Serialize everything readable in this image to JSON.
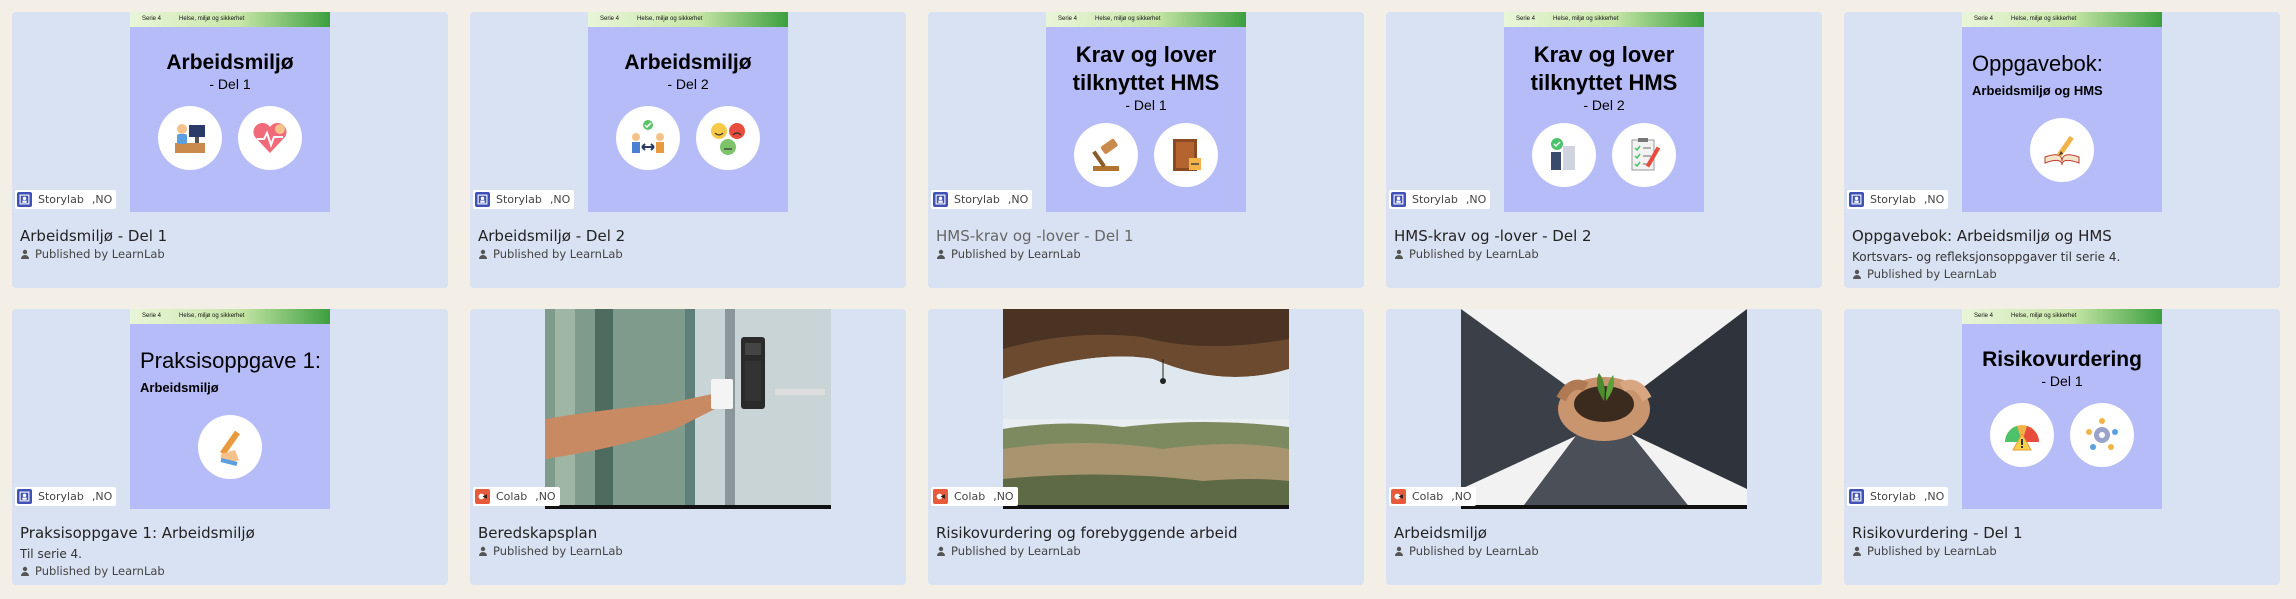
{
  "cover_bar": {
    "series": "Serie 4",
    "topic": "Helse, miljø og sikkerhet"
  },
  "publisher_prefix": "Published by",
  "cards": [
    {
      "title": "Arbeidsmiljø - Del 1",
      "publisher": "LearnLab",
      "source": "Storylab",
      "lang": ",NO",
      "cover_title": "Arbeidsmiljø",
      "cover_sub": "- Del 1",
      "icons": [
        "office-worker-icon",
        "heart-health-icon"
      ]
    },
    {
      "title": "Arbeidsmiljø - Del 2",
      "publisher": "LearnLab",
      "source": "Storylab",
      "lang": ",NO",
      "cover_title": "Arbeidsmiljø",
      "cover_sub": "- Del 2",
      "icons": [
        "people-exchange-icon",
        "mood-faces-icon"
      ]
    },
    {
      "title": "HMS-krav og -lover - Del 1",
      "publisher": "LearnLab",
      "source": "Storylab",
      "lang": ",NO",
      "cover_title_l1": "Krav og lover",
      "cover_title_l2": "tilknyttet HMS",
      "cover_sub": "- Del 1",
      "icons": [
        "gavel-icon",
        "law-book-icon"
      ]
    },
    {
      "title": "HMS-krav og -lover - Del 2",
      "publisher": "LearnLab",
      "source": "Storylab",
      "lang": ",NO",
      "cover_title_l1": "Krav og lover",
      "cover_title_l2": "tilknyttet HMS",
      "cover_sub": "- Del 2",
      "icons": [
        "safety-products-icon",
        "checklist-icon"
      ]
    },
    {
      "title": "Oppgavebok: Arbeidsmiljø og HMS",
      "description": "Kortsvars- og refleksjonsoppgaver til serie 4.",
      "publisher": "LearnLab",
      "source": "Storylab",
      "lang": ",NO",
      "cover_lead": "Oppgavebok:",
      "cover_lead_sub": "Arbeidsmiljø og HMS",
      "icons": [
        "notebook-pencil-icon"
      ]
    },
    {
      "title": "Praksisoppgave 1: Arbeidsmiljø",
      "description": "Til serie 4.",
      "publisher": "LearnLab",
      "source": "Storylab",
      "lang": ",NO",
      "cover_lead": "Praksisoppgave 1:",
      "cover_lead_sub": "Arbeidsmiljø",
      "icons": [
        "hand-writing-icon"
      ]
    },
    {
      "title": "Beredskapsplan",
      "publisher": "LearnLab",
      "source": "Colab",
      "lang": ",NO",
      "photo": "keycard-door-photo"
    },
    {
      "title": "Risikovurdering og forebyggende arbeid",
      "publisher": "LearnLab",
      "source": "Colab",
      "lang": ",NO",
      "photo": "climber-cave-photo"
    },
    {
      "title": "Arbeidsmiljø",
      "publisher": "LearnLab",
      "source": "Colab",
      "lang": ",NO",
      "photo": "hands-plant-photo"
    },
    {
      "title": "Risikovurdering - Del 1",
      "publisher": "LearnLab",
      "source": "Storylab",
      "lang": ",NO",
      "cover_title": "Risikovurdering",
      "cover_sub": "- Del 1",
      "icons": [
        "risk-gauge-icon",
        "gears-cycle-icon"
      ]
    }
  ],
  "colors": {
    "card_bg": "#d9e2f3",
    "cover_bg": "#b6bcf7",
    "page_bg": "#f3efe7",
    "storylab": "#3f51b5",
    "colab": "#e85a3c"
  }
}
